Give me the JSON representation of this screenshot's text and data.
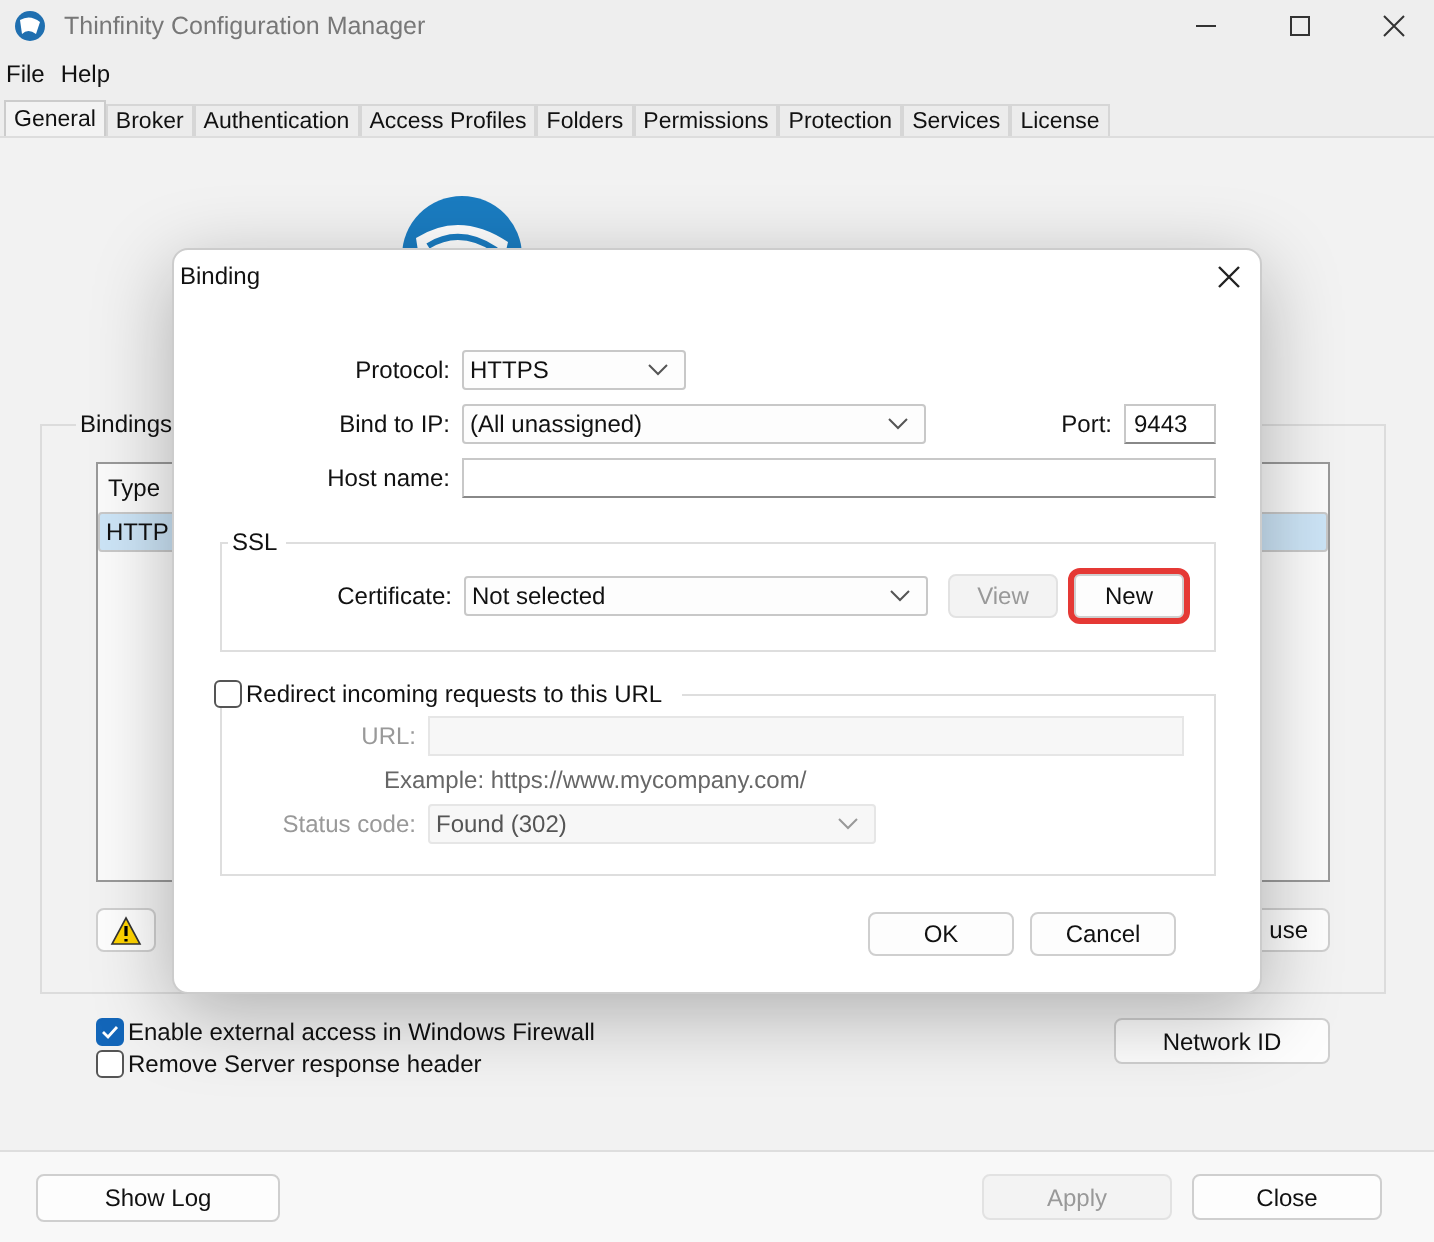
{
  "window": {
    "title": "Thinfinity Configuration Manager"
  },
  "menu": [
    "File",
    "Help"
  ],
  "tabs": [
    {
      "label": "General",
      "selected": true
    },
    {
      "label": "Broker",
      "selected": false
    },
    {
      "label": "Authentication",
      "selected": false
    },
    {
      "label": "Access Profiles",
      "selected": false
    },
    {
      "label": "Folders",
      "selected": false
    },
    {
      "label": "Permissions",
      "selected": false
    },
    {
      "label": "Protection",
      "selected": false
    },
    {
      "label": "Services",
      "selected": false
    },
    {
      "label": "License",
      "selected": false
    }
  ],
  "bindings": {
    "title": "Bindings",
    "columns": [
      "Type"
    ],
    "rows": [
      {
        "type": "HTTP",
        "selected": true
      }
    ],
    "buttons": [
      {
        "kind": "warning"
      },
      {
        "kind": "text",
        "label": "use"
      }
    ]
  },
  "options": [
    {
      "label": "Enable external access in Windows Firewall",
      "checked": true
    },
    {
      "label": "Remove Server response header",
      "checked": false
    }
  ],
  "network_id_button": "Network ID",
  "footer": {
    "show_log": "Show Log",
    "apply": {
      "label": "Apply",
      "disabled": true
    },
    "close": "Close"
  },
  "dialog": {
    "title": "Binding",
    "protocol": {
      "label": "Protocol:",
      "value": "HTTPS"
    },
    "bind_ip": {
      "label": "Bind to IP:",
      "value": "(All unassigned)"
    },
    "port": {
      "label": "Port:",
      "value": "9443"
    },
    "host_name": {
      "label": "Host name:"
    },
    "ssl": {
      "title": "SSL",
      "certificate": {
        "label": "Certificate:",
        "value": "Not selected"
      },
      "view": {
        "label": "View",
        "disabled": true
      },
      "new": {
        "label": "New",
        "highlighted": true
      }
    },
    "redirect": {
      "label": "Redirect incoming requests to this URL",
      "checked": false,
      "url": {
        "label": "URL:"
      },
      "example": "Example: https://www.mycompany.com/",
      "status_code": {
        "label": "Status code:",
        "value": "Found (302)"
      }
    },
    "buttons": [
      "OK",
      "Cancel"
    ]
  }
}
